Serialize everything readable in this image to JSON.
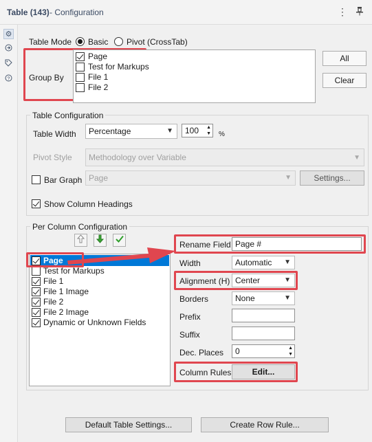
{
  "header": {
    "tool_name": "Table (143)",
    "subtitle": "- Configuration"
  },
  "table_mode": {
    "label": "Table Mode",
    "options": [
      "Basic",
      "Pivot (CrossTab)"
    ],
    "selected": "Basic"
  },
  "group_by": {
    "label": "Group By",
    "items": [
      {
        "label": "Page",
        "checked": true
      },
      {
        "label": "Test for Markups",
        "checked": false
      },
      {
        "label": "File 1",
        "checked": false
      },
      {
        "label": "File 2",
        "checked": false
      }
    ],
    "all_button": "All",
    "clear_button": "Clear"
  },
  "table_config": {
    "title": "Table Configuration",
    "width_label": "Table Width",
    "width_mode": "Percentage",
    "width_value": "100",
    "width_unit": "%",
    "pivot_style_label": "Pivot Style",
    "pivot_style_value": "Methodology over Variable",
    "bar_graph_label": "Bar Graph",
    "bar_graph_checked": false,
    "bar_graph_field": "Page",
    "settings_button": "Settings...",
    "show_headings_label": "Show Column Headings",
    "show_headings_checked": true
  },
  "per_column": {
    "title": "Per Column Configuration",
    "columns": [
      {
        "label": "Page",
        "checked": true
      },
      {
        "label": "Test for Markups",
        "checked": false
      },
      {
        "label": "File 1",
        "checked": true
      },
      {
        "label": "File 1 Image",
        "checked": true
      },
      {
        "label": "File 2",
        "checked": true
      },
      {
        "label": "File 2 Image",
        "checked": true
      },
      {
        "label": "Dynamic or Unknown Fields",
        "checked": true
      }
    ],
    "rename_field_label": "Rename Field",
    "rename_field_value": "Page #",
    "width_label": "Width",
    "width_value": "Automatic",
    "alignment_label": "Alignment (H)",
    "alignment_value": "Center",
    "borders_label": "Borders",
    "borders_value": "None",
    "prefix_label": "Prefix",
    "prefix_value": "",
    "suffix_label": "Suffix",
    "suffix_value": "",
    "dec_places_label": "Dec. Places",
    "dec_places_value": "0",
    "column_rules_label": "Column Rules",
    "edit_button": "Edit..."
  },
  "footer": {
    "default_settings_button": "Default Table Settings...",
    "create_row_rule_button": "Create Row Rule..."
  },
  "colors": {
    "highlight_red": "#e0464f",
    "selection_blue": "#0078d7"
  }
}
